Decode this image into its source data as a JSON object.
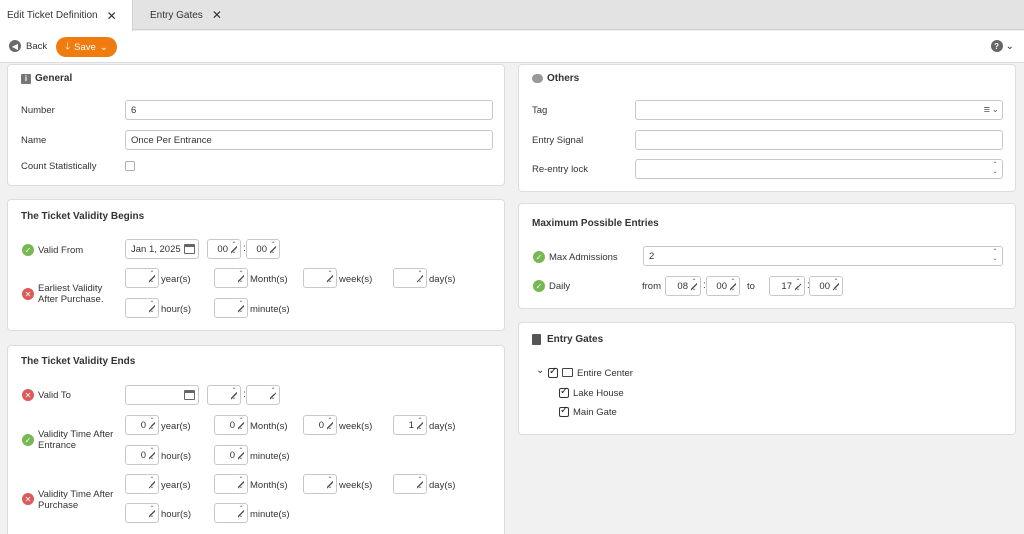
{
  "tabs": [
    {
      "label": "Edit Ticket Definition",
      "active": true
    },
    {
      "label": "Entry Gates",
      "active": false
    }
  ],
  "toolbar": {
    "back_label": "Back",
    "save_label": "Save"
  },
  "general": {
    "title": "General",
    "number_label": "Number",
    "number_value": "6",
    "name_label": "Name",
    "name_value": "Once Per Entrance",
    "count_label": "Count Statistically",
    "count_checked": false
  },
  "others": {
    "title": "Others",
    "tag_label": "Tag",
    "signal_label": "Entry Signal",
    "reentry_label": "Re-entry lock"
  },
  "begins": {
    "title": "The Ticket Validity Begins",
    "valid_from_label": "Valid From",
    "valid_from_date": "Jan 1, 2025",
    "valid_from_hour": "00",
    "valid_from_minute": "00",
    "earliest_label_1": "Earliest Validity",
    "earliest_label_2": "After Purchase."
  },
  "units": {
    "year": "year(s)",
    "month": "Month(s)",
    "week": "week(s)",
    "day": "day(s)",
    "hour": "hour(s)",
    "minute": "minute(s)"
  },
  "ends": {
    "title": "The Ticket Validity Ends",
    "valid_to_label": "Valid To",
    "after_entrance_1": "Validity Time After",
    "after_entrance_2": "Entrance",
    "ae_year": "0",
    "ae_month": "0",
    "ae_week": "0",
    "ae_day": "1",
    "ae_hour": "0",
    "ae_minute": "0",
    "after_purchase_1": "Validity Time After",
    "after_purchase_2": "Purchase"
  },
  "max_entries": {
    "title": "Maximum Possible Entries",
    "max_adm_label": "Max Admissions",
    "max_adm_value": "2",
    "daily_label": "Daily",
    "from_label": "from",
    "from_hour": "08",
    "from_minute": "00",
    "to_label": "to",
    "to_hour": "17",
    "to_minute": "00"
  },
  "gates": {
    "title": "Entry Gates",
    "root": "Entire Center",
    "children": [
      "Lake House",
      "Main Gate"
    ]
  },
  "colors": {
    "accent": "#f07c10",
    "ok": "#76b852",
    "error": "#dd5a5a"
  }
}
